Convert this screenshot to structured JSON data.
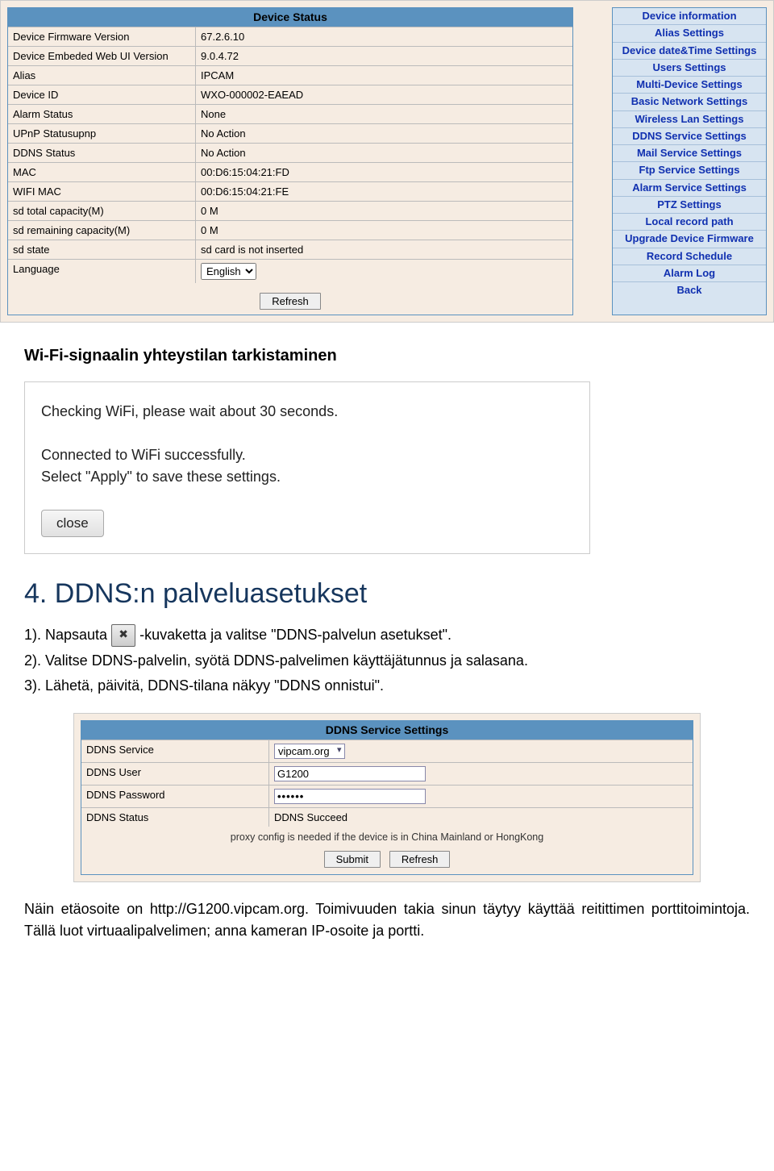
{
  "device_status": {
    "title": "Device Status",
    "rows": [
      {
        "k": "Device Firmware Version",
        "v": "67.2.6.10"
      },
      {
        "k": "Device Embeded Web UI Version",
        "v": "9.0.4.72"
      },
      {
        "k": "Alias",
        "v": "IPCAM"
      },
      {
        "k": "Device ID",
        "v": "WXO-000002-EAEAD"
      },
      {
        "k": "Alarm Status",
        "v": "None"
      },
      {
        "k": "UPnP Statusupnp",
        "v": "No Action"
      },
      {
        "k": "DDNS Status",
        "v": "No Action"
      },
      {
        "k": "MAC",
        "v": "00:D6:15:04:21:FD"
      },
      {
        "k": "WIFI MAC",
        "v": "00:D6:15:04:21:FE"
      },
      {
        "k": "sd total capacity(M)",
        "v": "0 M"
      },
      {
        "k": "sd remaining capacity(M)",
        "v": "0 M"
      },
      {
        "k": "sd state",
        "v": "sd card is not inserted"
      }
    ],
    "language_label": "Language",
    "language_value": "English",
    "refresh_label": "Refresh"
  },
  "side_menu": [
    "Device information",
    "Alias Settings",
    "Device date&Time Settings",
    "Users Settings",
    "Multi-Device Settings",
    "Basic Network Settings",
    "Wireless Lan Settings",
    "DDNS Service Settings",
    "Mail Service Settings",
    "Ftp Service Settings",
    "Alarm Service Settings",
    "PTZ Settings",
    "Local record path",
    "Upgrade Device Firmware",
    "Record Schedule",
    "Alarm Log",
    "Back"
  ],
  "doc": {
    "wifi_heading": "Wi-Fi-signaalin yhteystilan tarkistaminen",
    "wifi_shot": {
      "line1": "Checking WiFi, please wait about 30 seconds.",
      "line2": "Connected to WiFi successfully.",
      "line3": "Select \"Apply\" to save these settings.",
      "close": "close"
    },
    "section_title": "4. DDNS:n palveluasetukset",
    "steps": {
      "s1a": "1). Napsauta",
      "s1b": "-kuvaketta ja valitse \"DDNS-palvelun asetukset\".",
      "s2": "2). Valitse DDNS-palvelin, syötä DDNS-palvelimen käyttäjätunnus ja salasana.",
      "s3": "3). Lähetä, päivitä, DDNS-tilana näkyy \"DDNS onnistui\"."
    },
    "footer": "Näin etäosoite on http://G1200.vipcam.org. Toimivuuden takia sinun täytyy käyttää reitittimen porttitoimintoja. Tällä luot virtuaalipalvelimen; anna kameran IP-osoite ja portti."
  },
  "ddns": {
    "title": "DDNS Service Settings",
    "rows": {
      "service_k": "DDNS Service",
      "service_v": "vipcam.org",
      "user_k": "DDNS User",
      "user_v": "G1200",
      "pw_k": "DDNS Password",
      "pw_v": "••••••",
      "status_k": "DDNS Status",
      "status_v": "DDNS Succeed"
    },
    "proxy_note": "proxy config is needed if the device is in China Mainland or HongKong",
    "submit": "Submit",
    "refresh": "Refresh"
  }
}
